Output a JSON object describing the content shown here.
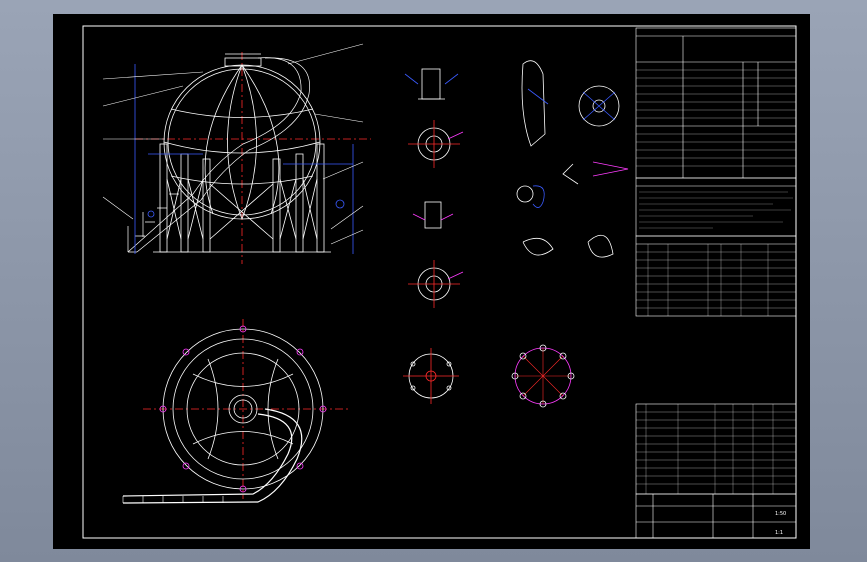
{
  "drawing": {
    "title_block": {
      "scale": "1:50",
      "sheet": "1:1"
    },
    "colors": {
      "background": "#000000",
      "frame": "#ffffff",
      "centerline": "#ff2a2a",
      "dimension": "#3a5bff",
      "hatch": "#ff3cff",
      "text": "#ffffff"
    }
  }
}
